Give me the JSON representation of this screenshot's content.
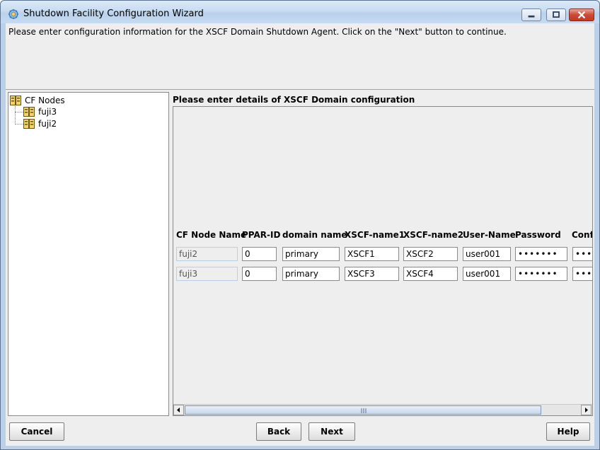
{
  "window": {
    "title": "Shutdown Facility Configuration Wizard"
  },
  "instruction": "Please enter configuration information for the XSCF Domain Shutdown Agent. Click on the \"Next\" button to continue.",
  "tree": {
    "root": "CF Nodes",
    "children": [
      "fuji3",
      "fuji2"
    ]
  },
  "section_label": "Please enter details of XSCF Domain configuration",
  "table": {
    "headers": [
      "CF Node Name",
      "PPAR-ID",
      "domain name",
      "XSCF-name1",
      "XSCF-name2",
      "User-Name",
      "Password",
      "Conf"
    ],
    "rows": [
      {
        "node": "fuji2",
        "ppar": "0",
        "domain": "primary",
        "xscf1": "XSCF1",
        "xscf2": "XSCF2",
        "user": "user001",
        "password": "•••••••",
        "confirm": "••••"
      },
      {
        "node": "fuji3",
        "ppar": "0",
        "domain": "primary",
        "xscf1": "XSCF3",
        "xscf2": "XSCF4",
        "user": "user001",
        "password": "•••••••",
        "confirm": "••••"
      }
    ]
  },
  "buttons": {
    "cancel": "Cancel",
    "back": "Back",
    "next": "Next",
    "help": "Help"
  },
  "icons": {
    "app": "gear-app-icon",
    "node": "server-node-icon"
  },
  "colors": {
    "titlebar": "#c8dcf1",
    "close_button": "#c23a22",
    "panel_bg": "#eeeeee"
  }
}
